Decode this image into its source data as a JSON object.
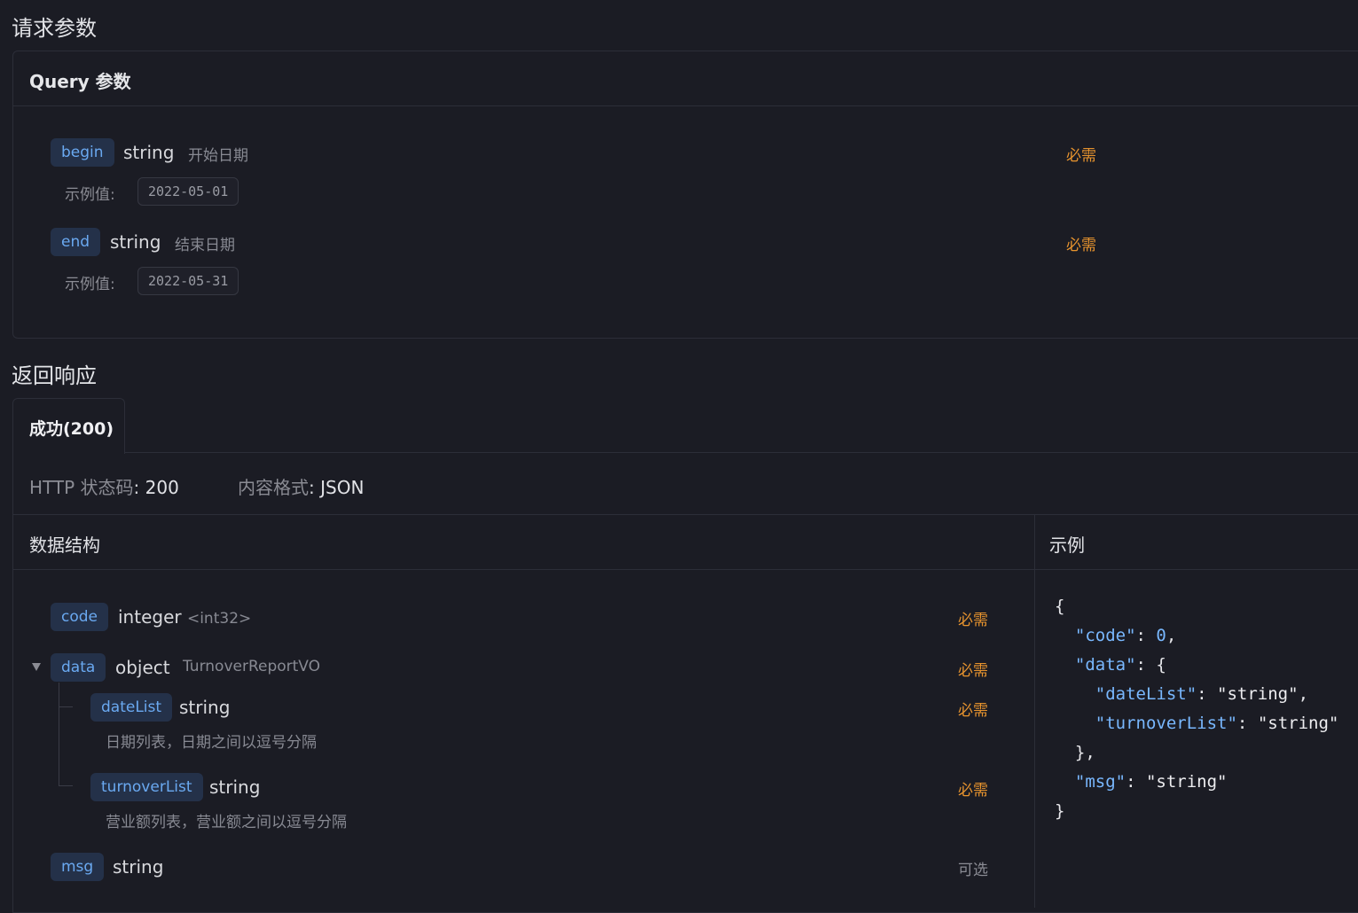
{
  "request": {
    "title": "请求参数",
    "query_title": "Query 参数",
    "example_label": "示例值:",
    "params": [
      {
        "name": "begin",
        "type": "string",
        "desc": "开始日期",
        "required": "必需",
        "example": "2022-05-01"
      },
      {
        "name": "end",
        "type": "string",
        "desc": "结束日期",
        "required": "必需",
        "example": "2022-05-31"
      }
    ]
  },
  "response": {
    "title": "返回响应",
    "tab": "成功(200)",
    "status_label": "HTTP 状态码",
    "status_value": "200",
    "format_label": "内容格式",
    "format_value": "JSON",
    "colon": ":",
    "structure_title": "数据结构",
    "example_title": "示例",
    "fields": {
      "code": {
        "name": "code",
        "type": "integer",
        "format": "<int32>",
        "required": "必需"
      },
      "data": {
        "name": "data",
        "type": "object",
        "ref": "TurnoverReportVO",
        "required": "必需"
      },
      "dateList": {
        "name": "dateList",
        "type": "string",
        "desc": "日期列表，日期之间以逗号分隔",
        "required": "必需"
      },
      "turnoverList": {
        "name": "turnoverList",
        "type": "string",
        "desc": "营业额列表，营业额之间以逗号分隔",
        "required": "必需"
      },
      "msg": {
        "name": "msg",
        "type": "string",
        "required": "可选"
      }
    },
    "example_json": {
      "code_key": "\"code\"",
      "code_val": "0",
      "data_key": "\"data\"",
      "dateList_key": "\"dateList\"",
      "turnoverList_key": "\"turnoverList\"",
      "msg_key": "\"msg\"",
      "string_val": "\"string\""
    }
  },
  "colors": {
    "tag_bg": "#243149",
    "tag_text": "#6aa9f1",
    "required": "#e8942e",
    "background": "#1b1c24"
  },
  "icons": {
    "collapse": "triangle-down-icon"
  }
}
